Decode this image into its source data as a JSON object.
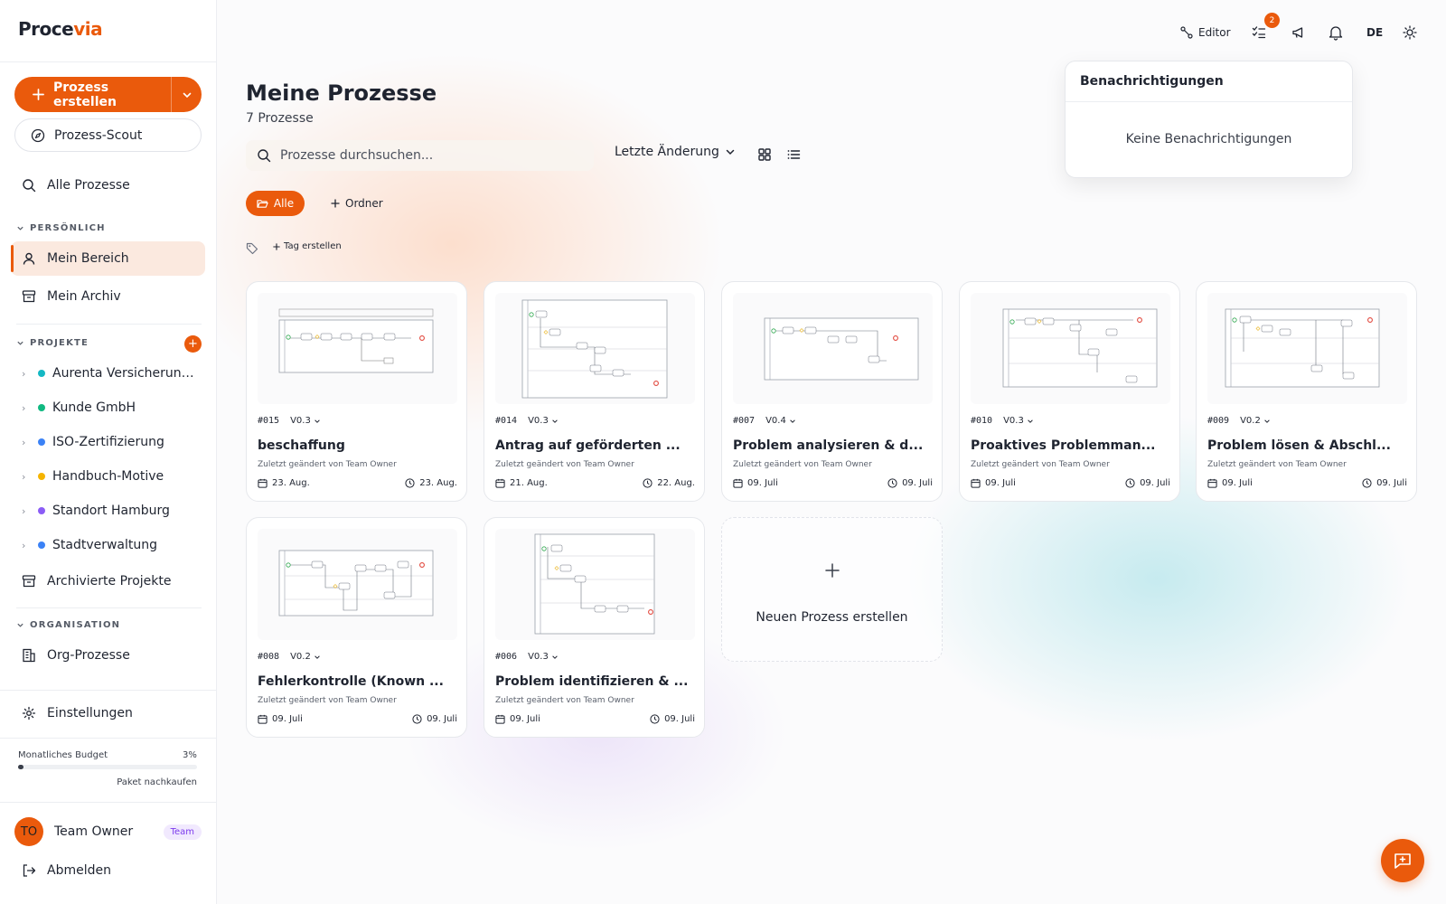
{
  "app": {
    "logo_part1": "Proce",
    "logo_part2": "via",
    "accent": "#ea5a0c"
  },
  "sidebar": {
    "create_button": "Prozess erstellen",
    "scout_button": "Prozess-Scout",
    "all_processes": "Alle Prozesse",
    "section_personal": "PERSÖNLICH",
    "my_area": "Mein Bereich",
    "my_archive": "Mein Archiv",
    "section_projects": "PROJEKTE",
    "projects_add": "+",
    "projects": [
      {
        "label": "Aurenta Versicherung ...",
        "color": "#14b8c4"
      },
      {
        "label": "Kunde GmbH",
        "color": "#10b981"
      },
      {
        "label": "ISO-Zertifizierung",
        "color": "#3b82f6"
      },
      {
        "label": "Handbuch-Motive",
        "color": "#f5b400"
      },
      {
        "label": "Standort Hamburg",
        "color": "#8b5cf6"
      },
      {
        "label": "Stadtverwaltung",
        "color": "#3b82f6"
      }
    ],
    "archived_projects": "Archivierte Projekte",
    "section_org": "ORGANISATION",
    "org_processes": "Org-Prozesse",
    "settings": "Einstellungen",
    "budget_label": "Monatliches Budget",
    "budget_percent": "3%",
    "budget_fraction": 0.03,
    "budget_buy": "Paket nachkaufen",
    "user_initials": "TO",
    "user_name": "Team Owner",
    "user_badge": "Team",
    "logout": "Abmelden"
  },
  "topbar": {
    "editor": "Editor",
    "tasks_badge": "2",
    "language": "DE"
  },
  "main": {
    "title": "Meine Prozesse",
    "count": "7 Prozesse",
    "search_placeholder": "Prozesse durchsuchen...",
    "sort_label": "Letzte Änderung",
    "chip_all": "Alle",
    "chip_folder": "Ordner",
    "tag_create": "Tag erstellen",
    "new_process": "Neuen Prozess erstellen"
  },
  "cards": [
    {
      "id": "#015",
      "version": "V0.3",
      "title": "beschaffung",
      "subtitle": "Zuletzt geändert von Team Owner",
      "created": "23. Aug.",
      "modified": "23. Aug."
    },
    {
      "id": "#014",
      "version": "V0.3",
      "title": "Antrag auf geförderten ...",
      "subtitle": "Zuletzt geändert von Team Owner",
      "created": "21. Aug.",
      "modified": "22. Aug."
    },
    {
      "id": "#007",
      "version": "V0.4",
      "title": "Problem analysieren & d...",
      "subtitle": "Zuletzt geändert von Team Owner",
      "created": "09. Juli",
      "modified": "09. Juli"
    },
    {
      "id": "#010",
      "version": "V0.3",
      "title": "Proaktives Problemman...",
      "subtitle": "Zuletzt geändert von Team Owner",
      "created": "09. Juli",
      "modified": "09. Juli"
    },
    {
      "id": "#009",
      "version": "V0.2",
      "title": "Problem lösen & Abschl...",
      "subtitle": "Zuletzt geändert von Team Owner",
      "created": "09. Juli",
      "modified": "09. Juli"
    },
    {
      "id": "#008",
      "version": "V0.2",
      "title": "Fehlerkontrolle (Known ...",
      "subtitle": "Zuletzt geändert von Team Owner",
      "created": "09. Juli",
      "modified": "09. Juli"
    },
    {
      "id": "#006",
      "version": "V0.3",
      "title": "Problem identifizieren & ...",
      "subtitle": "Zuletzt geändert von Team Owner",
      "created": "09. Juli",
      "modified": "09. Juli"
    }
  ],
  "notifications": {
    "title": "Benachrichtigungen",
    "empty": "Keine Benachrichtigungen"
  }
}
